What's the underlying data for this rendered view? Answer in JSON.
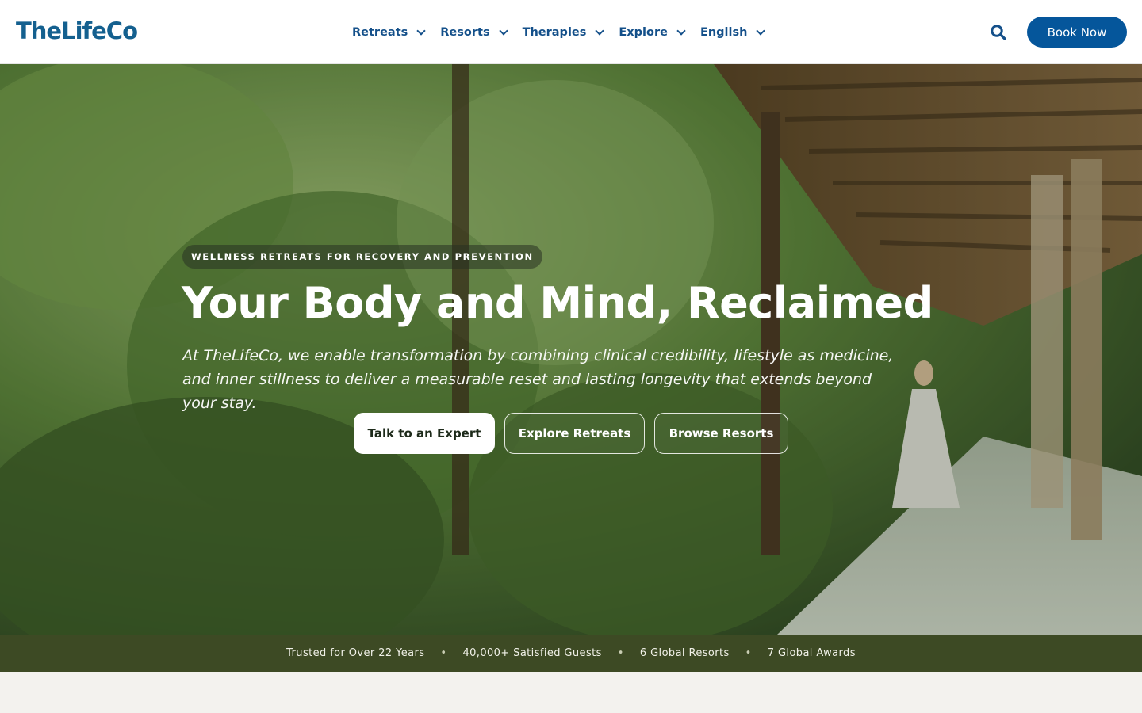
{
  "header": {
    "logo": "TheLifeCo",
    "nav": [
      {
        "label": "Retreats"
      },
      {
        "label": "Resorts"
      },
      {
        "label": "Therapies"
      },
      {
        "label": "Explore"
      },
      {
        "label": "English"
      }
    ],
    "search_icon": "search-icon",
    "book_label": "Book Now",
    "brand_color": "#05569b"
  },
  "hero": {
    "eyebrow": "WELLNESS RETREATS FOR RECOVERY AND PREVENTION",
    "headline": "Your Body and Mind, Reclaimed",
    "subtext": "At TheLifeCo, we enable transformation by combining clinical credibility, lifestyle as medicine, and inner stillness to deliver a measurable reset and lasting longevity that extends beyond your stay.",
    "buttons": {
      "primary": "Talk to an Expert",
      "explore": "Explore Retreats",
      "browse": "Browse Resorts"
    }
  },
  "stats": [
    "Trusted for Over 22 Years",
    "40,000+ Satisfied Guests",
    "6 Global Resorts",
    "7 Global Awards"
  ],
  "stats_separator": "•",
  "colors": {
    "stats_bg": "#3d4a24",
    "page_bg": "#f3f2ee"
  }
}
